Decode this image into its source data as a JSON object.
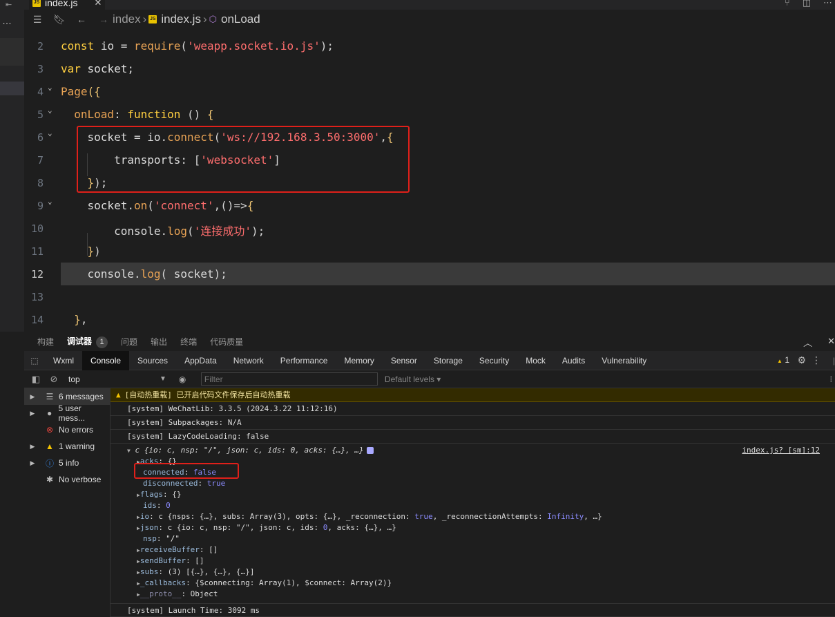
{
  "tab": {
    "filename": "index.js",
    "close": "✕"
  },
  "breadcrumb": {
    "items": [
      "index",
      "index.js",
      "onLoad"
    ]
  },
  "editor": {
    "line_numbers": [
      "2",
      "3",
      "4",
      "5",
      "6",
      "7",
      "8",
      "9",
      "10",
      "11",
      "12",
      "13",
      "14"
    ],
    "active_line": "12"
  },
  "bottom_panel": {
    "tabs": [
      "构建",
      "调试器",
      "问题",
      "输出",
      "终端",
      "代码质量"
    ],
    "debugger_badge": "1",
    "devtools_tabs": [
      "Wxml",
      "Console",
      "Sources",
      "AppData",
      "Network",
      "Performance",
      "Memory",
      "Sensor",
      "Storage",
      "Security",
      "Mock",
      "Audits",
      "Vulnerability"
    ],
    "warning_count": "1"
  },
  "filter": {
    "context": "top",
    "placeholder": "Filter",
    "levels": "Default levels"
  },
  "console_sidebar": [
    {
      "label": "6 messages",
      "icon": "list-icon"
    },
    {
      "label": "5 user mess...",
      "icon": "user-icon"
    },
    {
      "label": "No errors",
      "icon": "error-icon"
    },
    {
      "label": "1 warning",
      "icon": "warning-icon"
    },
    {
      "label": "5 info",
      "icon": "info-icon"
    },
    {
      "label": "No verbose",
      "icon": "bug-icon"
    }
  ],
  "console": {
    "messages": [
      "[自动热重载] 已开启代码文件保存后自动热重载",
      "[system] WeChatLib: 3.3.5 (2024.3.22 11:12:16)",
      "[system] Subpackages: N/A",
      "[system] LazyCodeLoading: false"
    ],
    "object_summary": "c {io: c, nsp: \"/\", json: c, ids: 0, acks: {…}, …}",
    "source_link": "index.js? [sm]:12",
    "last_message": "[system] Launch Time: 3092 ms"
  },
  "colors": {
    "warning_bg": "#332b00",
    "highlight_box": "#e0201a",
    "keyword": "#ffcf40",
    "string": "#ff6e6e"
  }
}
